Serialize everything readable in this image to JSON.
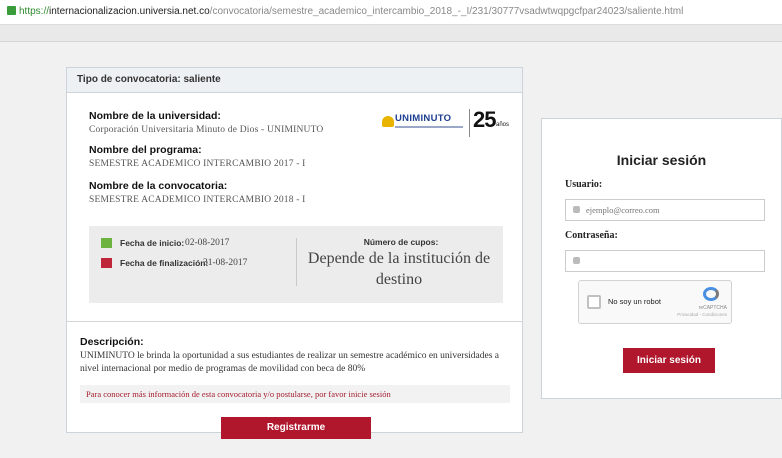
{
  "browser": {
    "url_scheme": "https://",
    "url_domain": "internacionalizacion.universia.net.co",
    "url_path": "/convocatoria/semestre_academico_intercambio_2018_-_I/231/30777vsadwtwqpgcfpar24023/saliente.html"
  },
  "convocatoria": {
    "header": "Tipo de convocatoria: saliente",
    "universidad_label": "Nombre de la universidad:",
    "universidad_value": "Corporación Universitaria Minuto de Dios - UNIMINUTO",
    "programa_label": "Nombre del programa:",
    "programa_value": "SEMESTRE ACADEMICO INTERCAMBIO 2017 - I",
    "convocatoria_label": "Nombre de la convocatoria:",
    "convocatoria_value": "SEMESTRE ACADEMICO INTERCAMBIO 2018 - I",
    "logo": {
      "brand": "UNIMINUTO",
      "anniversary_number": "25",
      "anniversary_word": "años",
      "brand_color": "#1d3f91",
      "accent": "#e8b400"
    },
    "fecha_inicio_label": "Fecha de inicio:",
    "fecha_inicio_value": "02-08-2017",
    "fecha_fin_label": "Fecha de finalización:",
    "fecha_fin_value": "31-08-2017",
    "fecha_inicio_color": "#6db33f",
    "fecha_fin_color": "#c0263a",
    "cupos_label": "Número de cupos:",
    "cupos_value": "Depende de la institución de destino",
    "descripcion_label": "Descripción:",
    "descripcion_value": "UNIMINUTO le brinda la oportunidad a sus estudiantes de realizar un semestre académico en universidades a nivel internacional por medio de programas de movilidad con beca de 80%",
    "notice": "Para conocer más información de esta convocatoria y/o postularse, por favor inicie sesión",
    "register_button": "Registrarme"
  },
  "login": {
    "title": "Iniciar sesión",
    "usuario_label": "Usuario:",
    "usuario_placeholder": "ejemplo@correo.com",
    "contrasena_label": "Contraseña:",
    "contrasena_placeholder": "",
    "captcha_text": "No soy un robot",
    "captcha_brand": "reCAPTCHA",
    "captcha_links": "Privacidad - Condiciones",
    "submit_button": "Iniciar sesión",
    "accent": "#b0162c"
  }
}
